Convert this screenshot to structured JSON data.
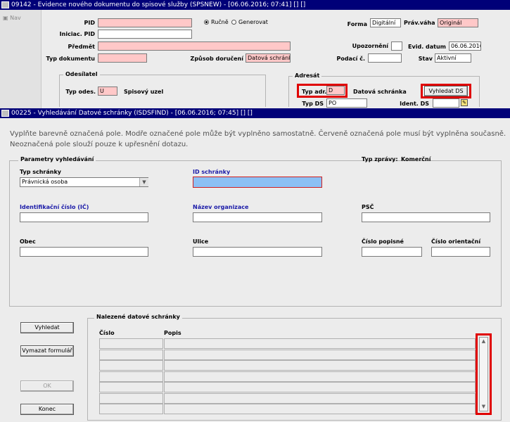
{
  "back_window": {
    "title": "09142 - Evidence nového dokumentu do spisové služby (SPSNEW) - [06.06.2016; 07:41] [] []",
    "nav_label": "Nav",
    "pid_label": "PID",
    "iniciac_label": "Iniciac. PID",
    "predmet_label": "Předmět",
    "typ_dokumentu_label": "Typ dokumentu",
    "radio_rucne": "Ručně",
    "radio_generovat": "Generovat",
    "forma_label": "Forma",
    "forma_value": "Digitální",
    "prav_vaha_label": "Práv.váha",
    "prav_vaha_value": "Originál",
    "upozorneni_label": "Upozornění",
    "evid_datum_label": "Evid. datum",
    "evid_datum_value": "06.06.2016",
    "zpusob_doruceni_label": "Způsob doručení",
    "zpusob_doruceni_value": "Datová schránka",
    "podaci_label": "Podací č.",
    "stav_label": "Stav",
    "stav_value": "Aktivní",
    "odesilatel_group": "Odesílatel",
    "typ_odes_label": "Typ odes.",
    "typ_odes_value": "U",
    "spisovy_uzel": "Spisový uzel",
    "adresat_group": "Adresát",
    "typ_adr_label": "Typ adr.",
    "typ_adr_value": "D",
    "datova_schranka": "Datová schránka",
    "vyhledat_ds": "Vyhledat DS",
    "typ_ds_label": "Typ DS",
    "typ_ds_value": "PO",
    "ident_ds_label": "Ident. DS"
  },
  "front_window": {
    "title": "00225 - Vyhledávání Datové schránky (ISDSFIND) - [06.06.2016; 07:45] [] []",
    "instruction_line1": "Vyplňte barevně označená pole. Modře označené pole může být vyplněno samostatně. Červeně označená pole musí být vyplněna současně.",
    "instruction_line2": "Neoznačená pole slouží pouze k upřesnění dotazu.",
    "params_group": "Parametry vyhledávání",
    "typ_zpravy_label": "Typ zprávy:",
    "typ_zpravy_value": "Komerční",
    "typ_schranky_label": "Typ schránky",
    "typ_schranky_value": "Právnická osoba",
    "id_schranky_label": "ID schránky",
    "ico_label": "Identifikační číslo (IČ)",
    "nazev_label": "Název organizace",
    "psc_label": "PSČ",
    "obec_label": "Obec",
    "ulice_label": "Ulice",
    "cislo_popisne_label": "Číslo popisné",
    "cislo_orientacni_label": "Číslo orientační",
    "results_group": "Nalezené datové schránky",
    "col_cislo": "Číslo",
    "col_popis": "Popis",
    "btn_vyhledat": "Vyhledat",
    "btn_vymazat": "Vymazat formulář",
    "btn_ok": "OK",
    "btn_konec": "Konec"
  },
  "colors": {
    "title_bar": "#000078",
    "required_field": "#ffc8c8",
    "standalone_field": "#8cc0f4",
    "highlight_box": "#e00000",
    "blue_label": "#1a1aa8"
  }
}
